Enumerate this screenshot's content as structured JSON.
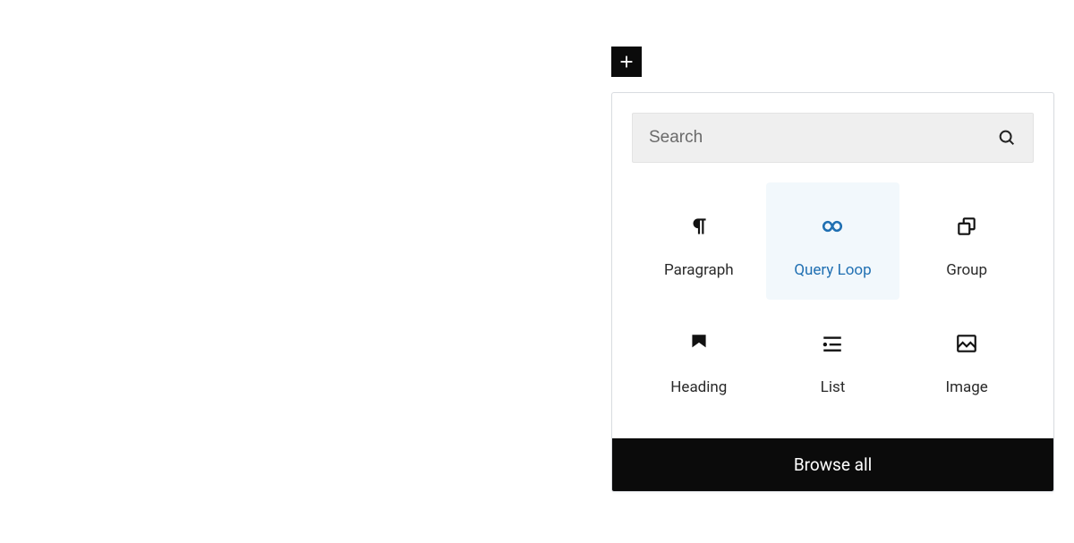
{
  "search": {
    "placeholder": "Search"
  },
  "blocks": {
    "items": [
      {
        "label": "Paragraph"
      },
      {
        "label": "Query Loop"
      },
      {
        "label": "Group"
      },
      {
        "label": "Heading"
      },
      {
        "label": "List"
      },
      {
        "label": "Image"
      }
    ]
  },
  "footer": {
    "browse_all": "Browse all"
  }
}
